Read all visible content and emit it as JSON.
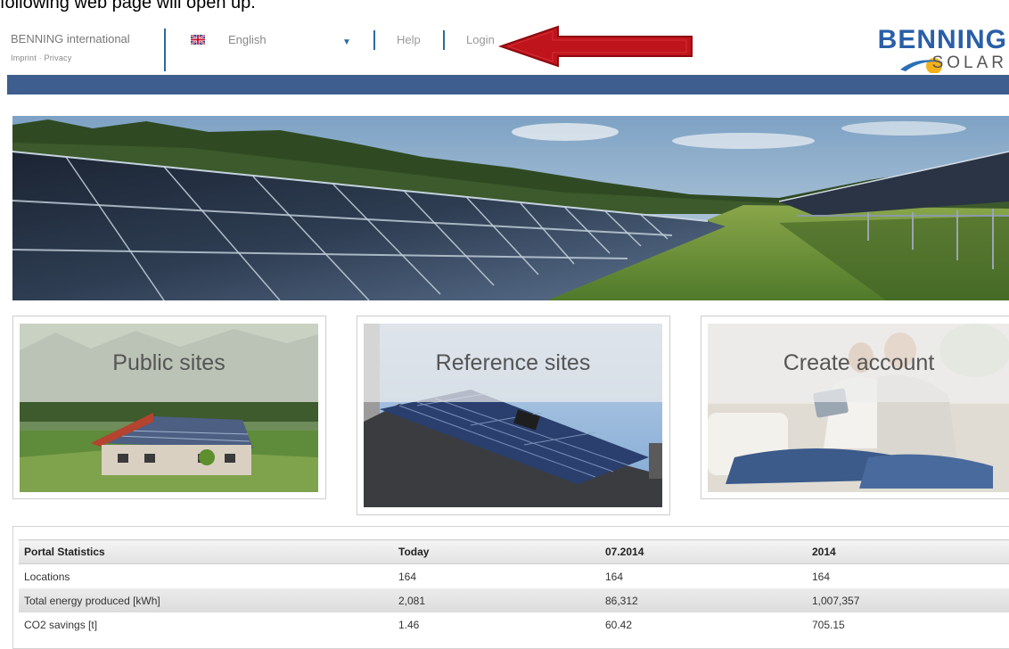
{
  "caption": "following web page will open up.",
  "header": {
    "brand_name": "BENNING international",
    "imprint": "Imprint",
    "link_sep": "·",
    "privacy": "Privacy",
    "language": "English",
    "help": "Help",
    "login": "Login",
    "logo_top": "BENNING",
    "logo_bottom": "SOLAR",
    "colors": {
      "brand": "#2a5fa8",
      "navbar": "#3d5e8e",
      "annotation_arrow": "#c0141c"
    }
  },
  "tiles": [
    {
      "title": "Public sites"
    },
    {
      "title": "Reference sites"
    },
    {
      "title": "Create account"
    }
  ],
  "stats": {
    "headers": [
      "Portal Statistics",
      "Today",
      "07.2014",
      "2014"
    ],
    "rows": [
      [
        "Locations",
        "164",
        "164",
        "164"
      ],
      [
        "Total energy produced [kWh]",
        "2,081",
        "86,312",
        "1,007,357"
      ],
      [
        "CO2 savings [t]",
        "1.46",
        "60.42",
        "705.15"
      ]
    ]
  }
}
